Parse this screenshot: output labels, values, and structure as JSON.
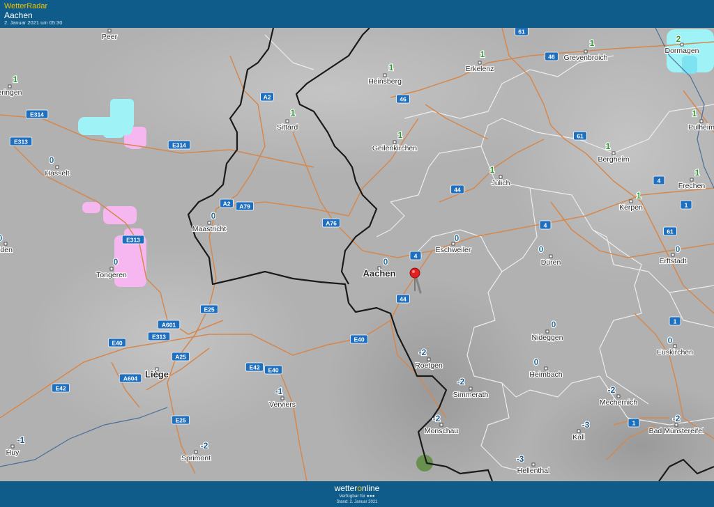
{
  "header": {
    "app_name": "WetterRadar",
    "location": "Aachen",
    "timestamp": "2. Januar 2021 um 05:30"
  },
  "footer": {
    "brand_before": "wetter",
    "brand_o": "o",
    "brand_after": "nline",
    "availability": "Verfügbar für ●●●",
    "as_of": "Stand: 2. Januar 2021"
  },
  "colors": {
    "bar": "#0f5c8a",
    "accent": "#f2c100",
    "map": "#b3b3b3",
    "road": "#d4884e",
    "border": "#1a1a1a",
    "road_shield": "#1f6fbf",
    "temp_positive": "#2f9a34",
    "temp_zero": "#2d6f96",
    "temp_negative": "#1f5a8c",
    "precip_rain": "#9ff2f6",
    "precip_snow": "#f6b7f0"
  },
  "marker": {
    "icon": "map-pin-icon",
    "place": "Aachen"
  },
  "cities": [
    {
      "name": "Peer"
    },
    {
      "name": "eringen"
    },
    {
      "name": "Hasselt"
    },
    {
      "name": "Tongeren"
    },
    {
      "name": "iden"
    },
    {
      "name": "Maastricht"
    },
    {
      "name": "Sittard"
    },
    {
      "name": "Heinsberg"
    },
    {
      "name": "Erkelenz"
    },
    {
      "name": "Grevenbroich"
    },
    {
      "name": "Dormagen"
    },
    {
      "name": "Pulheim"
    },
    {
      "name": "Geilenkirchen"
    },
    {
      "name": "Jülich"
    },
    {
      "name": "Bergheim"
    },
    {
      "name": "Frechen"
    },
    {
      "name": "Kerpen"
    },
    {
      "name": "Eschweiler"
    },
    {
      "name": "Aachen"
    },
    {
      "name": "Düren"
    },
    {
      "name": "Erftstadt"
    },
    {
      "name": "Liège"
    },
    {
      "name": "Verviers"
    },
    {
      "name": "Roetgen"
    },
    {
      "name": "Simmerath"
    },
    {
      "name": "Monschau"
    },
    {
      "name": "Nideggen"
    },
    {
      "name": "Heimbach"
    },
    {
      "name": "Euskirchen"
    },
    {
      "name": "Mechernich"
    },
    {
      "name": "Bad Münstereifel"
    },
    {
      "name": "Kall"
    },
    {
      "name": "Hellenthal"
    },
    {
      "name": "Huy"
    },
    {
      "name": "Sprimont"
    }
  ],
  "temperatures": [
    {
      "value": "1"
    },
    {
      "value": "0"
    },
    {
      "value": "0"
    },
    {
      "value": "0"
    },
    {
      "value": "1"
    },
    {
      "value": "1"
    },
    {
      "value": "1"
    },
    {
      "value": "1"
    },
    {
      "value": "2"
    },
    {
      "value": "1"
    },
    {
      "value": "1"
    },
    {
      "value": "1"
    },
    {
      "value": "1"
    },
    {
      "value": "1"
    },
    {
      "value": "1"
    },
    {
      "value": "0"
    },
    {
      "value": "0"
    },
    {
      "value": "0"
    },
    {
      "value": "0"
    },
    {
      "value": "0"
    },
    {
      "value": "-1"
    },
    {
      "value": "-2"
    },
    {
      "value": "-2"
    },
    {
      "value": "-2"
    },
    {
      "value": "0"
    },
    {
      "value": "0"
    },
    {
      "value": "0"
    },
    {
      "value": "-2"
    },
    {
      "value": "-2"
    },
    {
      "value": "-3"
    },
    {
      "value": "-3"
    },
    {
      "value": "-1"
    },
    {
      "value": "-2"
    }
  ],
  "road_labels": [
    {
      "text": "E314"
    },
    {
      "text": "E313"
    },
    {
      "text": "E314"
    },
    {
      "text": "A2"
    },
    {
      "text": "A2"
    },
    {
      "text": "A79"
    },
    {
      "text": "A76"
    },
    {
      "text": "E313"
    },
    {
      "text": "E25"
    },
    {
      "text": "A601"
    },
    {
      "text": "E313"
    },
    {
      "text": "E40"
    },
    {
      "text": "A25"
    },
    {
      "text": "A604"
    },
    {
      "text": "E42"
    },
    {
      "text": "E25"
    },
    {
      "text": "E40"
    },
    {
      "text": "E42"
    },
    {
      "text": "E40"
    },
    {
      "text": "4"
    },
    {
      "text": "44"
    },
    {
      "text": "44"
    },
    {
      "text": "46"
    },
    {
      "text": "61"
    },
    {
      "text": "46"
    },
    {
      "text": "61"
    },
    {
      "text": "4"
    },
    {
      "text": "4"
    },
    {
      "text": "1"
    },
    {
      "text": "61"
    },
    {
      "text": "1"
    },
    {
      "text": "1"
    }
  ]
}
